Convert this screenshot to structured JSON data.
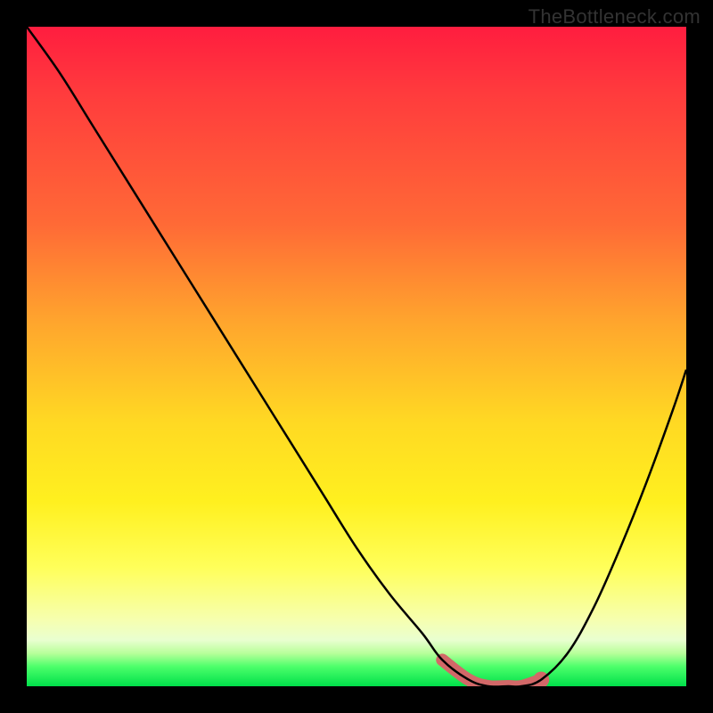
{
  "watermark": "TheBottleneck.com",
  "chart_data": {
    "type": "line",
    "title": "",
    "xlabel": "",
    "ylabel": "",
    "xlim": [
      0,
      100
    ],
    "ylim": [
      0,
      100
    ],
    "grid": false,
    "series": [
      {
        "name": "bottleneck-curve",
        "x": [
          0,
          5,
          10,
          15,
          20,
          25,
          30,
          35,
          40,
          45,
          50,
          55,
          60,
          63,
          67,
          70,
          73,
          75,
          78,
          82,
          86,
          90,
          94,
          98,
          100
        ],
        "values": [
          100,
          93,
          85,
          77,
          69,
          61,
          53,
          45,
          37,
          29,
          21,
          14,
          8,
          4,
          1,
          0,
          0,
          0,
          1,
          5,
          12,
          21,
          31,
          42,
          48
        ]
      }
    ],
    "highlight": {
      "name": "optimal-range",
      "x_start": 63,
      "x_end": 78,
      "dot_x": 78
    },
    "background_gradient": {
      "stops": [
        {
          "pos": 0,
          "color": "#ff1d3f"
        },
        {
          "pos": 30,
          "color": "#ff6a36"
        },
        {
          "pos": 60,
          "color": "#ffd923"
        },
        {
          "pos": 82,
          "color": "#ffff5a"
        },
        {
          "pos": 97,
          "color": "#4dff6b"
        },
        {
          "pos": 100,
          "color": "#00e04a"
        }
      ]
    }
  }
}
